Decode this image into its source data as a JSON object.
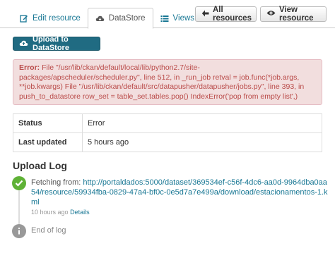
{
  "tabs": [
    {
      "label": "Edit resource",
      "icon": "edit-icon"
    },
    {
      "label": "DataStore",
      "icon": "cloud-icon"
    },
    {
      "label": "Views",
      "icon": "list-icon"
    }
  ],
  "header_buttons": {
    "all_resources": "All resources",
    "view_resource": "View resource"
  },
  "upload_button": "Upload to DataStore",
  "error": {
    "label": "Error:",
    "message": "File \"/usr/lib/ckan/default/local/lib/python2.7/site-packages/apscheduler/scheduler.py\", line 512, in _run_job retval = job.func(*job.args, **job.kwargs) File \"/usr/lib/ckan/default/src/datapusher/datapusher/jobs.py\", line 393, in push_to_datastore row_set = table_set.tables.pop() IndexError('pop from empty list',)"
  },
  "status_table": [
    {
      "key": "Status",
      "value": "Error"
    },
    {
      "key": "Last updated",
      "value": "5 hours ago"
    }
  ],
  "upload_log": {
    "title": "Upload Log",
    "entry_prefix": "Fetching from: ",
    "entry_url": "http://portaldados:5000/dataset/369534ef-c56f-4dc6-aa0d-9964dba0aa54/resource/59934fba-0829-47a4-bf0c-0e5d7a7e499a/download/estacionamentos-1.kml",
    "entry_time": "10 hours ago",
    "entry_details": "Details",
    "end": "End of log"
  },
  "colors": {
    "link": "#187794",
    "primary_button": "#206b82",
    "error_bg": "#f2dede",
    "error_text": "#b94a48",
    "success_dot": "#5fb236"
  }
}
